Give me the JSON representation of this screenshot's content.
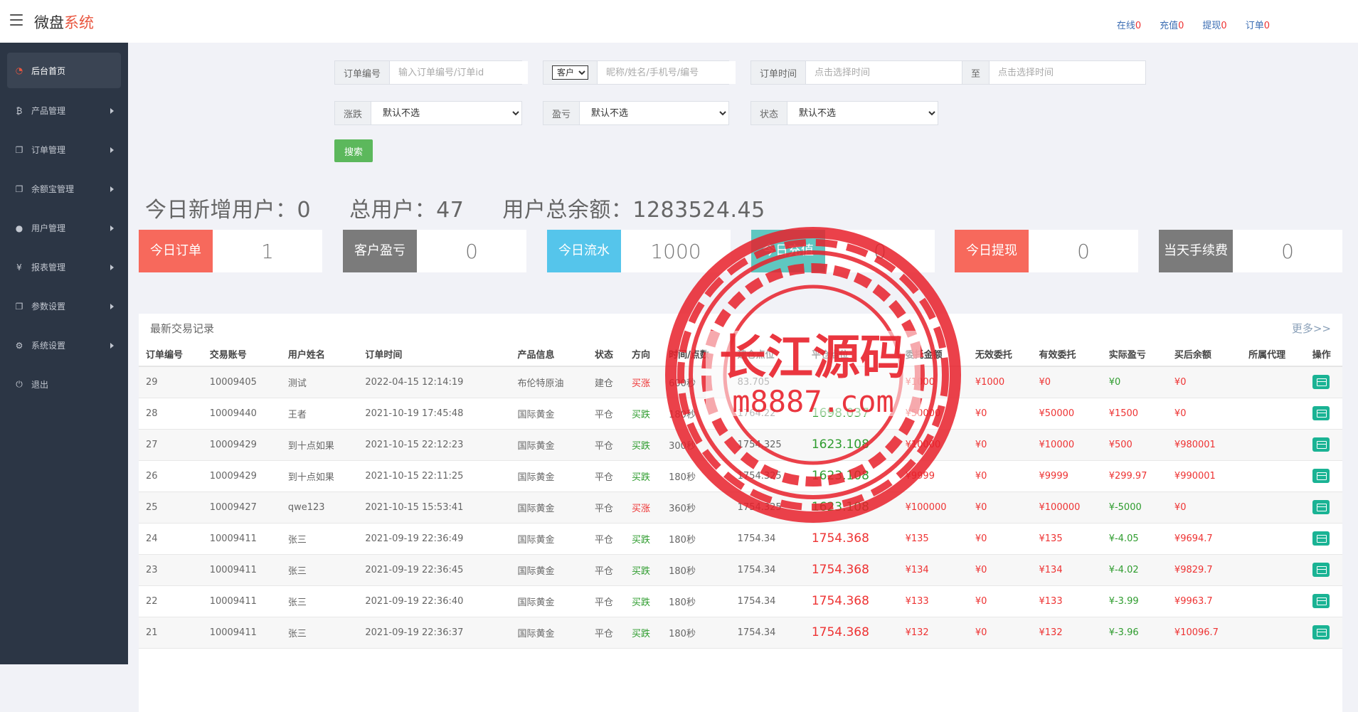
{
  "header": {
    "brand_main": "微盘",
    "brand_accent": "系统",
    "links": [
      {
        "label": "在线",
        "count": "0"
      },
      {
        "label": "充值",
        "count": "0"
      },
      {
        "label": "提现",
        "count": "0"
      },
      {
        "label": "订单",
        "count": "0"
      }
    ]
  },
  "sidebar": {
    "items": [
      {
        "label": "后台首页",
        "icon": "dashboard-icon",
        "glyph": "◔"
      },
      {
        "label": "产品管理",
        "icon": "bitcoin-icon",
        "glyph": "₿"
      },
      {
        "label": "订单管理",
        "icon": "copy-icon",
        "glyph": "❐"
      },
      {
        "label": "余额宝管理",
        "icon": "copy-icon",
        "glyph": "❐"
      },
      {
        "label": "用户管理",
        "icon": "user-icon",
        "glyph": "●"
      },
      {
        "label": "报表管理",
        "icon": "yen-icon",
        "glyph": "¥"
      },
      {
        "label": "参数设置",
        "icon": "copy-icon",
        "glyph": "❐"
      },
      {
        "label": "系统设置",
        "icon": "gears-icon",
        "glyph": "⚙"
      },
      {
        "label": "退出",
        "icon": "power-icon",
        "glyph": "⏻"
      }
    ]
  },
  "filters": {
    "order_no_label": "订单编号",
    "order_no_placeholder": "输入订单编号/订单id",
    "customer_select": "客户",
    "customer_placeholder": "昵称/姓名/手机号/编号",
    "order_time_label": "订单时间",
    "time_start_placeholder": "点击选择时间",
    "to_label": "至",
    "time_end_placeholder": "点击选择时间",
    "rise_fall_label": "涨跌",
    "profit_label": "盈亏",
    "status_label": "状态",
    "default_option": "默认不选",
    "search_button": "搜索"
  },
  "stats": {
    "new_users": "今日新增用户：0",
    "total_users": "总用户：47",
    "total_balance": "用户总余额：1283524.45"
  },
  "cards": [
    {
      "label1": "今日",
      "label2": "订单",
      "value": "1",
      "color": "#f7695c"
    },
    {
      "label1": "客户",
      "label2": "盈亏",
      "value": "0",
      "color": "#7b7b7b"
    },
    {
      "label1": "今日",
      "label2": "流水",
      "value": "1000",
      "color": "#55c5eb"
    },
    {
      "label1": "今日",
      "label2": "充值",
      "value": "0",
      "color": "#5fc7c0"
    },
    {
      "label1": "今日",
      "label2": "提现",
      "value": "0",
      "color": "#f7695c"
    },
    {
      "label1": "当天",
      "label2": "手续费",
      "value": "0",
      "color": "#7b7b7b"
    }
  ],
  "trades": {
    "title": "最新交易记录",
    "more": "更多>>",
    "columns": [
      "订单编号",
      "交易账号",
      "用户姓名",
      "订单时间",
      "产品信息",
      "状态",
      "方向",
      "时间/点数",
      "建仓点位",
      "平仓点位",
      "委托金额",
      "无效委托",
      "有效委托",
      "实际盈亏",
      "买后余额",
      "所属代理",
      "操作"
    ],
    "rows": [
      {
        "id": "29",
        "account": "10009405",
        "name": "测试",
        "time": "2022-04-15 12:14:19",
        "product": "布伦特原油",
        "status": "建仓",
        "dir": "买涨",
        "dir_color": "red",
        "period": "600秒",
        "open": "83.705",
        "close": "",
        "close_color": "green",
        "amount": "¥1000",
        "invalid": "¥1000",
        "valid": "¥0",
        "pl": "¥0",
        "pl_color": "green",
        "balance": "¥0",
        "agent": ""
      },
      {
        "id": "28",
        "account": "10009440",
        "name": "王者",
        "time": "2021-10-19 17:45:48",
        "product": "国际黄金",
        "status": "平仓",
        "dir": "买跌",
        "dir_color": "green",
        "period": "180秒",
        "open": "1764.22",
        "close": "1698.037",
        "close_color": "green",
        "amount": "¥50000",
        "invalid": "¥0",
        "valid": "¥50000",
        "pl": "¥1500",
        "pl_color": "red",
        "balance": "¥0",
        "agent": ""
      },
      {
        "id": "27",
        "account": "10009429",
        "name": "到十点如果",
        "time": "2021-10-15 22:12:23",
        "product": "国际黄金",
        "status": "平仓",
        "dir": "买跌",
        "dir_color": "green",
        "period": "300秒",
        "open": "1754.325",
        "close": "1623.108",
        "close_color": "green",
        "amount": "¥10000",
        "invalid": "¥0",
        "valid": "¥10000",
        "pl": "¥500",
        "pl_color": "red",
        "balance": "¥980001",
        "agent": ""
      },
      {
        "id": "26",
        "account": "10009429",
        "name": "到十点如果",
        "time": "2021-10-15 22:11:25",
        "product": "国际黄金",
        "status": "平仓",
        "dir": "买跌",
        "dir_color": "green",
        "period": "180秒",
        "open": "1754.325",
        "close": "1623.108",
        "close_color": "green",
        "amount": "¥9999",
        "invalid": "¥0",
        "valid": "¥9999",
        "pl": "¥299.97",
        "pl_color": "red",
        "balance": "¥990001",
        "agent": ""
      },
      {
        "id": "25",
        "account": "10009427",
        "name": "qwe123",
        "time": "2021-10-15 15:53:41",
        "product": "国际黄金",
        "status": "平仓",
        "dir": "买涨",
        "dir_color": "red",
        "period": "360秒",
        "open": "1754.325",
        "close": "1623.108",
        "close_color": "green",
        "amount": "¥100000",
        "invalid": "¥0",
        "valid": "¥100000",
        "pl": "¥-5000",
        "pl_color": "green",
        "balance": "¥0",
        "agent": ""
      },
      {
        "id": "24",
        "account": "10009411",
        "name": "张三",
        "time": "2021-09-19 22:36:49",
        "product": "国际黄金",
        "status": "平仓",
        "dir": "买跌",
        "dir_color": "green",
        "period": "180秒",
        "open": "1754.34",
        "close": "1754.368",
        "close_color": "red",
        "amount": "¥135",
        "invalid": "¥0",
        "valid": "¥135",
        "pl": "¥-4.05",
        "pl_color": "green",
        "balance": "¥9694.7",
        "agent": ""
      },
      {
        "id": "23",
        "account": "10009411",
        "name": "张三",
        "time": "2021-09-19 22:36:45",
        "product": "国际黄金",
        "status": "平仓",
        "dir": "买跌",
        "dir_color": "green",
        "period": "180秒",
        "open": "1754.34",
        "close": "1754.368",
        "close_color": "red",
        "amount": "¥134",
        "invalid": "¥0",
        "valid": "¥134",
        "pl": "¥-4.02",
        "pl_color": "green",
        "balance": "¥9829.7",
        "agent": ""
      },
      {
        "id": "22",
        "account": "10009411",
        "name": "张三",
        "time": "2021-09-19 22:36:40",
        "product": "国际黄金",
        "status": "平仓",
        "dir": "买跌",
        "dir_color": "green",
        "period": "180秒",
        "open": "1754.34",
        "close": "1754.368",
        "close_color": "red",
        "amount": "¥133",
        "invalid": "¥0",
        "valid": "¥133",
        "pl": "¥-3.99",
        "pl_color": "green",
        "balance": "¥9963.7",
        "agent": ""
      },
      {
        "id": "21",
        "account": "10009411",
        "name": "张三",
        "time": "2021-09-19 22:36:37",
        "product": "国际黄金",
        "status": "平仓",
        "dir": "买跌",
        "dir_color": "green",
        "period": "180秒",
        "open": "1754.34",
        "close": "1754.368",
        "close_color": "red",
        "amount": "¥132",
        "invalid": "¥0",
        "valid": "¥132",
        "pl": "¥-3.96",
        "pl_color": "green",
        "balance": "¥10096.7",
        "agent": ""
      }
    ]
  },
  "watermark": {
    "title": "长江源码",
    "url": "m8887.com",
    "color": "#e8202a"
  }
}
